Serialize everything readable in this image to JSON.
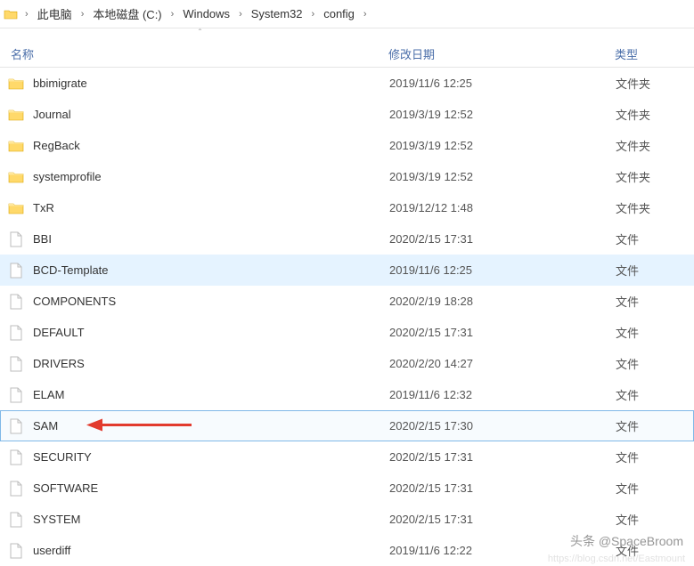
{
  "breadcrumb": {
    "separator": "›",
    "items": [
      {
        "label": "此电脑"
      },
      {
        "label": "本地磁盘 (C:)"
      },
      {
        "label": "Windows"
      },
      {
        "label": "System32"
      },
      {
        "label": "config"
      }
    ]
  },
  "sort_indicator": "ˆ",
  "columns": {
    "name": "名称",
    "date": "修改日期",
    "type": "类型"
  },
  "rows": [
    {
      "name": "bbimigrate",
      "date": "2019/11/6 12:25",
      "type": "文件夹",
      "icon": "folder",
      "state": ""
    },
    {
      "name": "Journal",
      "date": "2019/3/19 12:52",
      "type": "文件夹",
      "icon": "folder",
      "state": ""
    },
    {
      "name": "RegBack",
      "date": "2019/3/19 12:52",
      "type": "文件夹",
      "icon": "folder",
      "state": ""
    },
    {
      "name": "systemprofile",
      "date": "2019/3/19 12:52",
      "type": "文件夹",
      "icon": "folder",
      "state": ""
    },
    {
      "name": "TxR",
      "date": "2019/12/12 1:48",
      "type": "文件夹",
      "icon": "folder",
      "state": ""
    },
    {
      "name": "BBI",
      "date": "2020/2/15 17:31",
      "type": "文件",
      "icon": "file",
      "state": ""
    },
    {
      "name": "BCD-Template",
      "date": "2019/11/6 12:25",
      "type": "文件",
      "icon": "file",
      "state": "hovered"
    },
    {
      "name": "COMPONENTS",
      "date": "2020/2/19 18:28",
      "type": "文件",
      "icon": "file",
      "state": ""
    },
    {
      "name": "DEFAULT",
      "date": "2020/2/15 17:31",
      "type": "文件",
      "icon": "file",
      "state": ""
    },
    {
      "name": "DRIVERS",
      "date": "2020/2/20 14:27",
      "type": "文件",
      "icon": "file",
      "state": ""
    },
    {
      "name": "ELAM",
      "date": "2019/11/6 12:32",
      "type": "文件",
      "icon": "file",
      "state": ""
    },
    {
      "name": "SAM",
      "date": "2020/2/15 17:30",
      "type": "文件",
      "icon": "file",
      "state": "selected",
      "arrow": true
    },
    {
      "name": "SECURITY",
      "date": "2020/2/15 17:31",
      "type": "文件",
      "icon": "file",
      "state": ""
    },
    {
      "name": "SOFTWARE",
      "date": "2020/2/15 17:31",
      "type": "文件",
      "icon": "file",
      "state": ""
    },
    {
      "name": "SYSTEM",
      "date": "2020/2/15 17:31",
      "type": "文件",
      "icon": "file",
      "state": ""
    },
    {
      "name": "userdiff",
      "date": "2019/11/6 12:22",
      "type": "文件",
      "icon": "file",
      "state": ""
    }
  ],
  "watermark1": "头条 @SpaceBroom",
  "watermark2": "https://blog.csdn.net/Eastmount"
}
